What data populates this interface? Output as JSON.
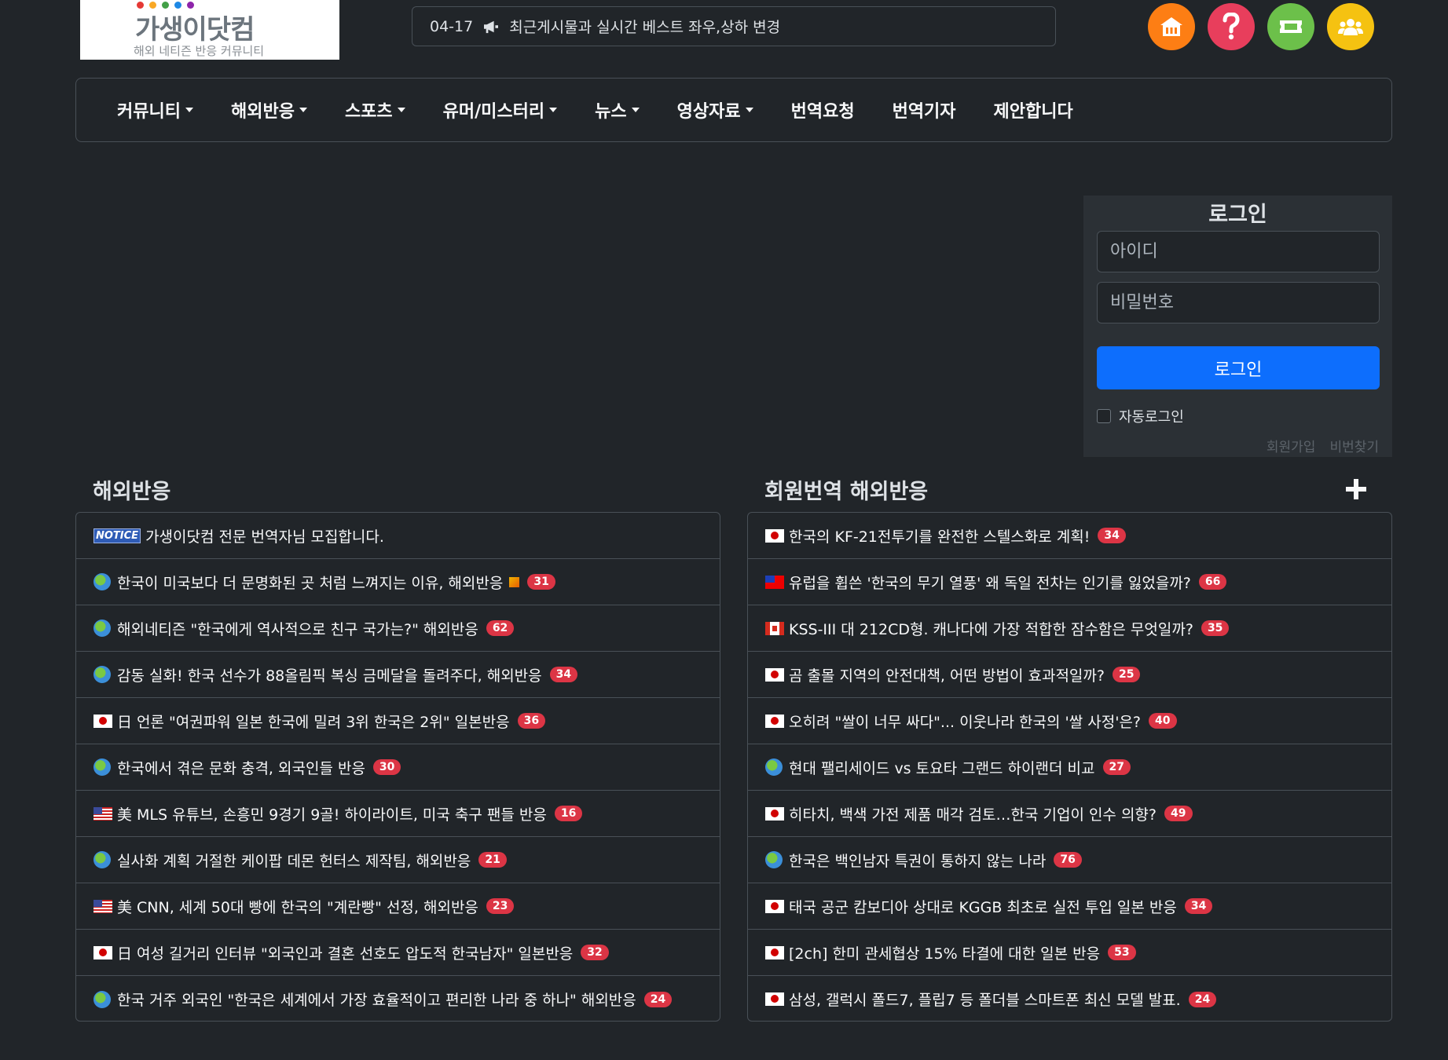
{
  "logo": {
    "title": "가생이닷컴",
    "subtitle": "해외 네티즌 반응 커뮤니티",
    "dot_colors": [
      "#e53935",
      "#f9a825",
      "#43a047",
      "#1e88e5",
      "#8e24aa"
    ]
  },
  "notice": {
    "date": "04-17",
    "icon": "megaphone-icon",
    "text": "최근게시물과 실시간 베스트 좌우,상하 변경"
  },
  "top_icons": [
    {
      "name": "home-icon",
      "color": "#fd7e14"
    },
    {
      "name": "question-icon",
      "color": "#e83e5c"
    },
    {
      "name": "ticket-icon",
      "color": "#6cc04a"
    },
    {
      "name": "users-icon",
      "color": "#f5c211"
    }
  ],
  "nav": [
    {
      "label": "커뮤니티",
      "dropdown": true
    },
    {
      "label": "해외반응",
      "dropdown": true
    },
    {
      "label": "스포츠",
      "dropdown": true
    },
    {
      "label": "유머/미스터리",
      "dropdown": true
    },
    {
      "label": "뉴스",
      "dropdown": true
    },
    {
      "label": "영상자료",
      "dropdown": true
    },
    {
      "label": "번역요청",
      "dropdown": false
    },
    {
      "label": "번역기자",
      "dropdown": false
    },
    {
      "label": "제안합니다",
      "dropdown": false
    }
  ],
  "login": {
    "title": "로그인",
    "id_placeholder": "아이디",
    "pw_placeholder": "비밀번호",
    "button": "로그인",
    "auto_login": "자동로그인",
    "signup": "회원가입",
    "find_pw": "비번찾기"
  },
  "left_section": {
    "title": "해외반응",
    "notice_tag": "NOTICE",
    "items": [
      {
        "flag": "notice",
        "text": "가생이닷컴 전문 번역자님 모집합니다.",
        "count": "",
        "has_image": false
      },
      {
        "flag": "globe",
        "text": "한국이 미국보다 더 문명화된 곳 처럼 느껴지는 이유, 해외반응",
        "count": "31",
        "has_image": true
      },
      {
        "flag": "globe",
        "text": "해외네티즌 \"한국에게 역사적으로 친구 국가는?\" 해외반응",
        "count": "62",
        "has_image": false
      },
      {
        "flag": "globe",
        "text": "감동 실화! 한국 선수가 88올림픽 복싱 금메달을 돌려주다, 해외반응",
        "count": "34",
        "has_image": false
      },
      {
        "flag": "jp",
        "text": "日 언론 \"여권파워 일본 한국에 밀려 3위 한국은 2위\" 일본반응",
        "count": "36",
        "has_image": false
      },
      {
        "flag": "globe",
        "text": "한국에서 겪은 문화 충격, 외국인들 반응",
        "count": "30",
        "has_image": false
      },
      {
        "flag": "us",
        "text": "美 MLS 유튜브, 손흥민 9경기 9골! 하이라이트, 미국 축구 팬들 반응",
        "count": "16",
        "has_image": false
      },
      {
        "flag": "globe",
        "text": "실사화 계획 거절한 케이팝 데몬 헌터스 제작팀, 해외반응",
        "count": "21",
        "has_image": false
      },
      {
        "flag": "us",
        "text": "美 CNN, 세계 50대 빵에 한국의 \"계란빵\" 선정, 해외반응",
        "count": "23",
        "has_image": false
      },
      {
        "flag": "jp",
        "text": "日 여성 길거리 인터뷰 \"외국인과 결혼 선호도 압도적 한국남자\" 일본반응",
        "count": "32",
        "has_image": false
      },
      {
        "flag": "globe",
        "text": "한국 거주 외국인 \"한국은 세계에서 가장 효율적이고 편리한 나라 중 하나\" 해외반응",
        "count": "24",
        "has_image": false
      }
    ]
  },
  "right_section": {
    "title": "회원번역 해외반응",
    "items": [
      {
        "flag": "jp",
        "text": "한국의 KF-21전투기를 완전한 스텔스화로 계획!",
        "count": "34"
      },
      {
        "flag": "tw",
        "text": "유럽을 휩쓴 '한국의 무기 열풍' 왜 독일 전차는 인기를 잃었을까?",
        "count": "66"
      },
      {
        "flag": "ca",
        "text": "KSS-III 대 212CD형. 캐나다에 가장 적합한 잠수함은 무엇일까?",
        "count": "35"
      },
      {
        "flag": "jp",
        "text": "곰 출몰 지역의 안전대책, 어떤 방법이 효과적일까?",
        "count": "25"
      },
      {
        "flag": "jp",
        "text": "오히려 \"쌀이 너무 싸다\"... 이웃나라 한국의 '쌀 사정'은?",
        "count": "40"
      },
      {
        "flag": "globe",
        "text": "현대 팰리세이드 vs 토요타 그랜드 하이랜더 비교",
        "count": "27"
      },
      {
        "flag": "jp",
        "text": "히타치, 백색 가전 제품 매각 검토…한국 기업이 인수 의향?",
        "count": "49"
      },
      {
        "flag": "globe",
        "text": "한국은 백인남자 특권이 통하지 않는 나라",
        "count": "76"
      },
      {
        "flag": "jp",
        "text": "태국 공군 캄보디아 상대로 KGGB 최초로 실전 투입 일본 반응",
        "count": "34"
      },
      {
        "flag": "jp",
        "text": "[2ch] 한미 관세협상 15% 타결에 대한 일본 반응",
        "count": "53"
      },
      {
        "flag": "jp",
        "text": "삼성, 갤럭시 폴드7, 플립7 등 폴더블 스마트폰 최신 모델 발표.",
        "count": "24"
      }
    ]
  }
}
